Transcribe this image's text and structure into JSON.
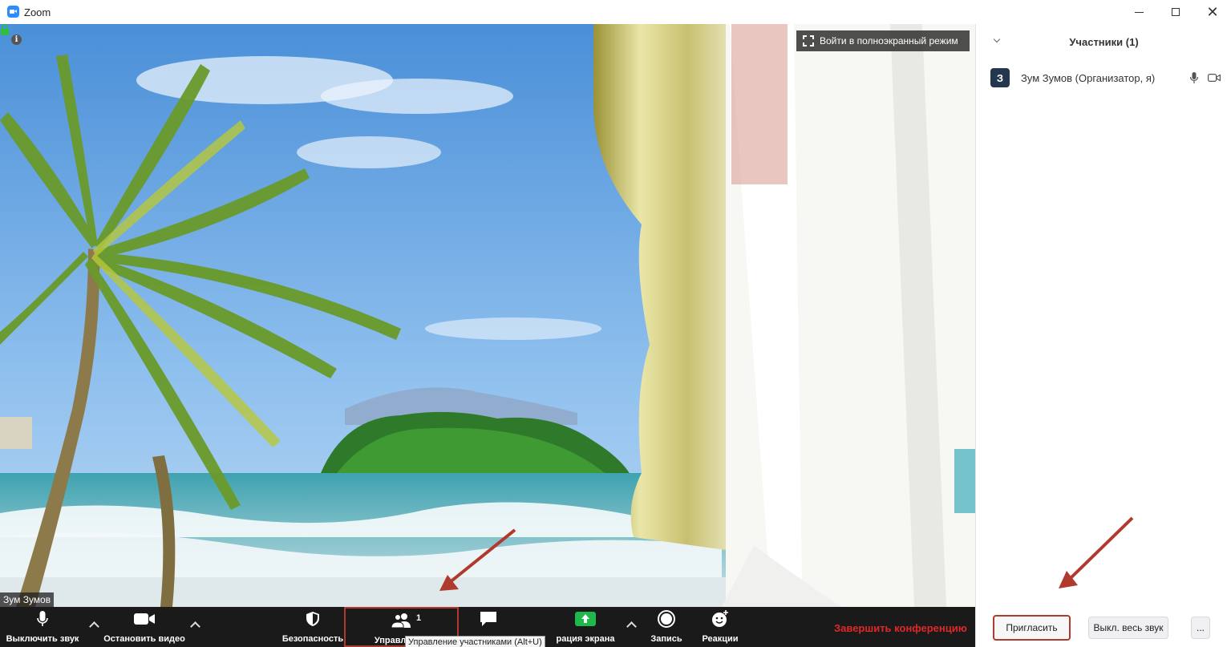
{
  "window": {
    "title": "Zoom"
  },
  "video": {
    "fullscreen_label": "Войти в полноэкранный режим",
    "name_tag": "Зум Зумов"
  },
  "toolbar": {
    "mute_label": "Выключить звук",
    "video_label": "Остановить видео",
    "security_label": "Безопасность",
    "participants_label": "Управлять у",
    "participants_count": "1",
    "chat_label": "Чат",
    "share_label": "рация экрана",
    "record_label": "Запись",
    "reactions_label": "Реакции",
    "end_label": "Завершить конференцию",
    "tooltip": "Управление участниками (Alt+U)"
  },
  "sidebar": {
    "title": "Участники (1)",
    "participants": [
      {
        "initial": "З",
        "name": "Зум Зумов (Организатор, я)"
      }
    ],
    "invite_label": "Пригласить",
    "mute_all_label": "Выкл. весь звук",
    "more_label": "..."
  },
  "colors": {
    "toolbar_bg": "#1a1a1a",
    "end_red": "#e02828",
    "share_green": "#1db94a",
    "avatar_bg": "#23384e",
    "annotation_red": "#b03a2e"
  }
}
